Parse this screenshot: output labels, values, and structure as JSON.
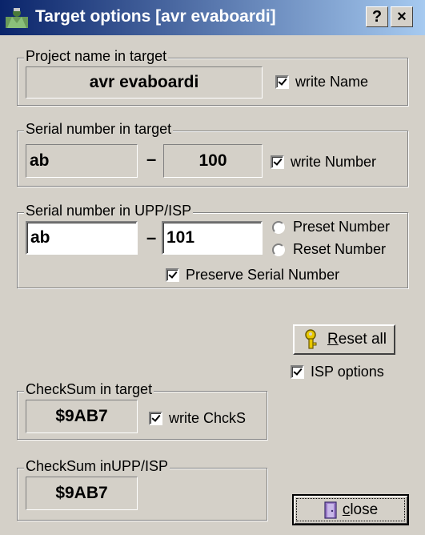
{
  "window": {
    "title": "Target options [avr evaboardi]",
    "help_button": "?",
    "close_button": "×"
  },
  "project": {
    "legend": "Project name in target",
    "value": "avr evaboardi",
    "write_label": "write Name",
    "write_checked": true
  },
  "serial_target": {
    "legend": "Serial number in target",
    "prefix": "ab",
    "dash": "–",
    "number": "100",
    "write_label": "write Number",
    "write_checked": true
  },
  "serial_upp": {
    "legend": "Serial number in UPP/ISP",
    "prefix": "ab",
    "dash": "–",
    "number": "101",
    "preset_label": "Preset Number",
    "reset_label": "Reset Number",
    "preserve_label": "Preserve Serial Number",
    "preserve_checked": true
  },
  "reset_all": {
    "label": "Reset all",
    "icon": "key-icon"
  },
  "isp_options": {
    "label": "ISP options",
    "checked": true
  },
  "checksum_target": {
    "legend": "CheckSum in target",
    "value": "$9AB7",
    "write_label": "write ChckS",
    "write_checked": true
  },
  "checksum_upp": {
    "legend": "CheckSum inUPP/ISP",
    "value": "$9AB7"
  },
  "close": {
    "label": "close",
    "icon": "door-icon"
  }
}
